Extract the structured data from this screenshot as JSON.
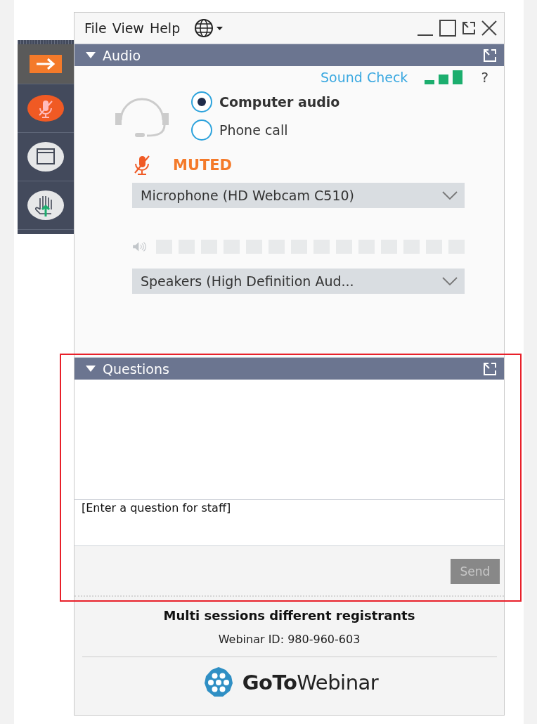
{
  "menu": [
    {
      "label": "File"
    },
    {
      "label": "View"
    },
    {
      "label": "Help"
    }
  ],
  "audio": {
    "title": "Audio",
    "sound_check": "Sound Check",
    "help": "?",
    "options": [
      {
        "label": "Computer audio",
        "selected": true
      },
      {
        "label": "Phone call",
        "selected": false
      }
    ],
    "mute_status": "MUTED",
    "microphone": "Microphone (HD Webcam C510)",
    "speakers": "Speakers (High Definition Aud..."
  },
  "questions": {
    "title": "Questions",
    "placeholder": "[Enter a question for staff]",
    "send": {
      "label": "Send",
      "disabled": true
    }
  },
  "footer": {
    "session_title": "Multi sessions different registrants",
    "webinar_id": "Webinar ID: 980-960-603",
    "logo": "**GoTo**Webinar"
  }
}
